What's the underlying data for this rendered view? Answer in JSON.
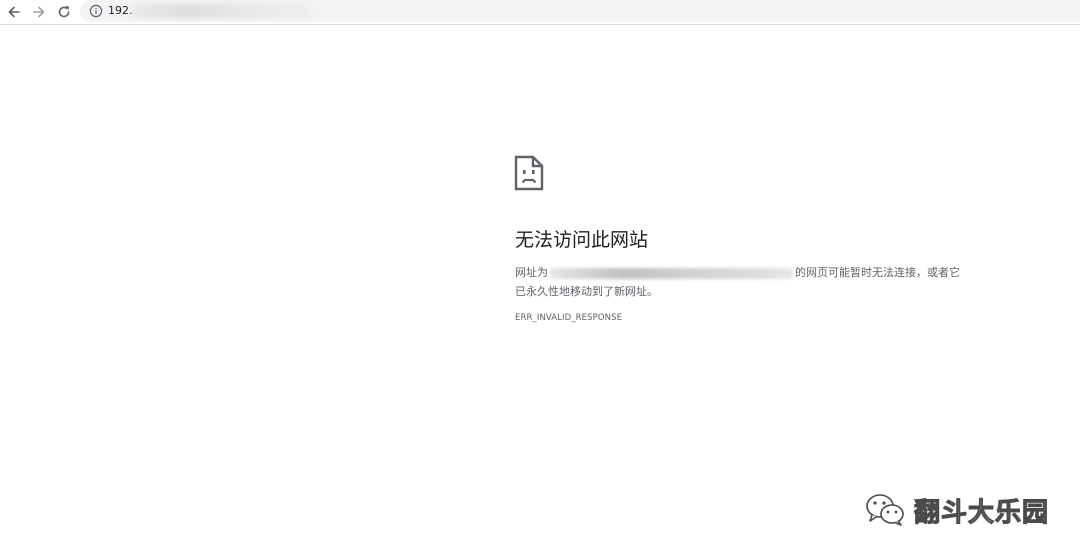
{
  "browser": {
    "url_visible": "192.",
    "icons": {
      "back": "back-arrow-icon",
      "forward": "forward-arrow-icon",
      "reload": "reload-icon",
      "site_info": "info-icon"
    }
  },
  "error_page": {
    "icon": "sad-document-icon",
    "title": "无法访问此网站",
    "desc_prefix": "网址为",
    "desc_suffix": "的网页可能暂时无法连接，或者它",
    "desc_line2": "已永久性地移动到了新网址。",
    "error_code": "ERR_INVALID_RESPONSE"
  },
  "watermark": {
    "icon": "wechat-icon",
    "text": "翻斗大乐园"
  },
  "colors": {
    "toolbar_bg": "#ffffff",
    "omnibox_bg": "#f1f3f4",
    "title_text": "#202124",
    "body_text": "#5f6368"
  }
}
